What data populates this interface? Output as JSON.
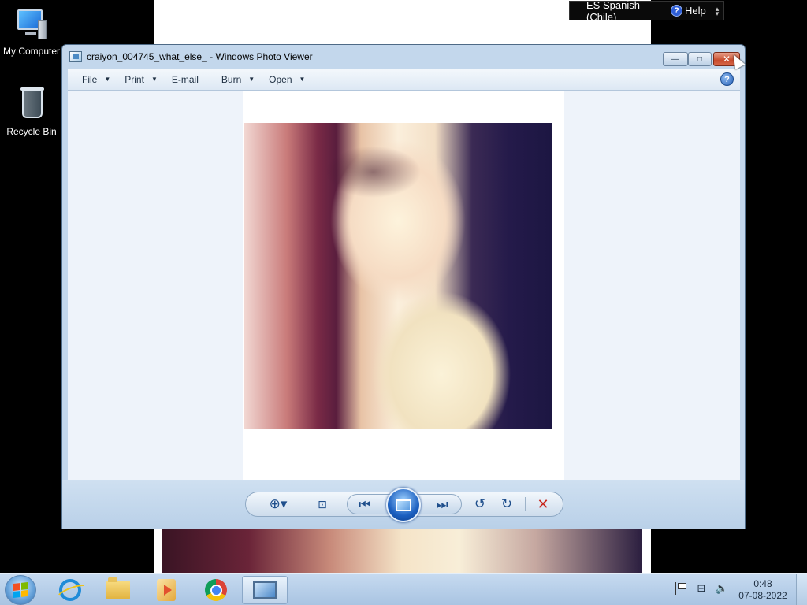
{
  "desktop": {
    "icons": [
      {
        "label": "My Computer",
        "icon": "computer-icon"
      },
      {
        "label": "Recycle Bin",
        "icon": "recycle-bin-icon"
      }
    ]
  },
  "langbar": {
    "language": "ES Spanish (Chile)",
    "help_label": "Help"
  },
  "window": {
    "title": "craiyon_004745_what_else_ - Windows Photo Viewer",
    "buttons": {
      "minimize": "—",
      "maximize": "□",
      "close": "✕"
    },
    "menu": [
      {
        "label": "File",
        "has_dropdown": true
      },
      {
        "label": "Print",
        "has_dropdown": true
      },
      {
        "label": "E-mail",
        "has_dropdown": false
      },
      {
        "label": "Burn",
        "has_dropdown": true
      },
      {
        "label": "Open",
        "has_dropdown": true
      }
    ],
    "help_glyph": "?",
    "controls": {
      "zoom": "⊕▾",
      "fit": "⊡",
      "prev": "⏮",
      "next": "⏭",
      "rotate_left": "↺",
      "rotate_right": "↻",
      "delete": "✕"
    }
  },
  "taskbar": {
    "apps": [
      "internet-explorer-icon",
      "windows-explorer-icon",
      "media-player-icon",
      "chrome-icon",
      "photo-viewer-icon"
    ],
    "time": "0:48",
    "date": "07-08-2022"
  }
}
